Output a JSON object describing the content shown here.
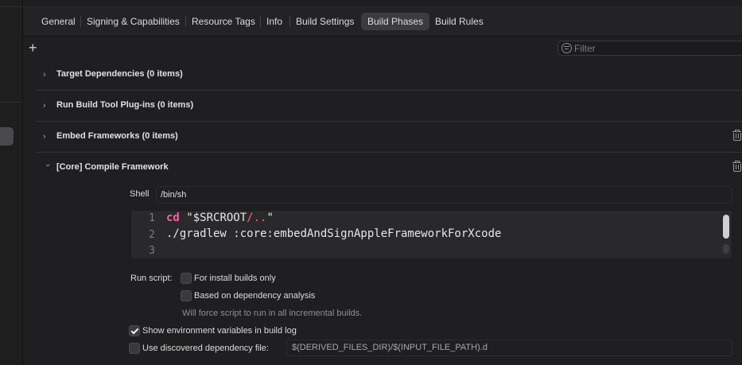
{
  "tabs": [
    {
      "label": "General",
      "active": false
    },
    {
      "label": "Signing & Capabilities",
      "active": false
    },
    {
      "label": "Resource Tags",
      "active": false
    },
    {
      "label": "Info",
      "active": false
    },
    {
      "label": "Build Settings",
      "active": false
    },
    {
      "label": "Build Phases",
      "active": true
    },
    {
      "label": "Build Rules",
      "active": false
    }
  ],
  "toolbar": {
    "add_label": "+",
    "filter_placeholder": "Filter"
  },
  "phases": [
    {
      "title": "Target Dependencies (0 items)",
      "expanded": false,
      "deletable": false
    },
    {
      "title": "Run Build Tool Plug-ins (0 items)",
      "expanded": false,
      "deletable": false
    },
    {
      "title": "Embed Frameworks (0 items)",
      "expanded": false,
      "deletable": true
    },
    {
      "title": "[Core] Compile Framework",
      "expanded": true,
      "deletable": true
    }
  ],
  "script_phase": {
    "shell_label": "Shell",
    "shell_value": "/bin/sh",
    "line_numbers": [
      "1",
      "2",
      "3"
    ],
    "code": {
      "line1_keyword": "cd",
      "line1_string_a": "\"$SRCROOT",
      "line1_string_b": "/..",
      "line1_string_c": "\"",
      "line2": "./gradlew :core:embedAndSignAppleFrameworkForXcode",
      "line3": ""
    },
    "run_script_label": "Run script:",
    "install_builds_label": "For install builds only",
    "install_builds_checked": false,
    "dependency_analysis_label": "Based on dependency analysis",
    "dependency_analysis_checked": false,
    "dependency_hint": "Will force script to run in all incremental builds.",
    "show_env_label": "Show environment variables in build log",
    "show_env_checked": true,
    "use_depfile_label": "Use discovered dependency file:",
    "use_depfile_checked": false,
    "depfile_value": "$(DERIVED_FILES_DIR)/$(INPUT_FILE_PATH).d"
  },
  "colors": {
    "keyword": "#fc5fa3",
    "string": "#fc6a5d",
    "active_tab": "#3c3c3f"
  }
}
